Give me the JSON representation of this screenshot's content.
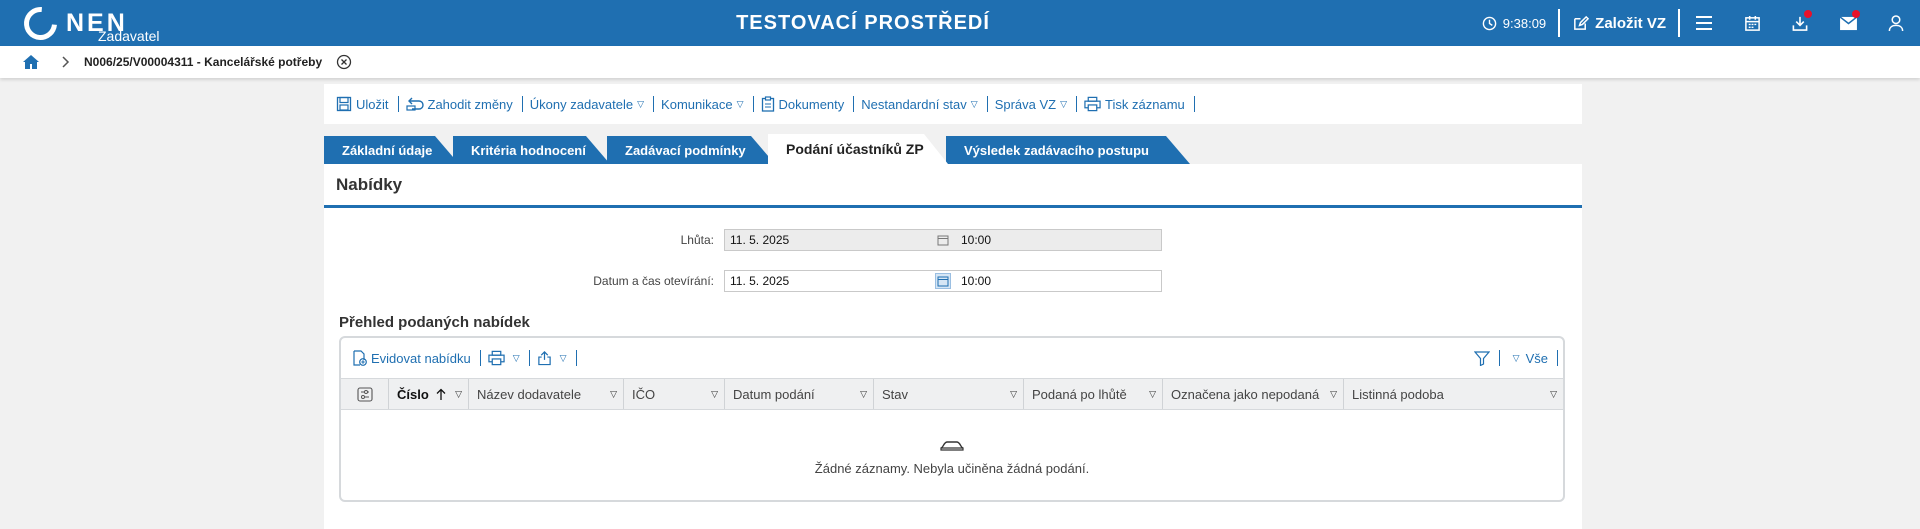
{
  "header": {
    "logo_text": "NEN",
    "logo_sub": "Zadavatel",
    "environment_title": "TESTOVACÍ PROSTŘEDÍ",
    "clock": "9:38:09",
    "create_label": "Založit VZ",
    "icons": [
      "clock-icon",
      "edit-icon",
      "menu-icon",
      "calendar-icon",
      "download-icon",
      "mail-icon",
      "user-icon"
    ]
  },
  "breadcrumb": {
    "label": "N006/25/V00004311 - Kancelářské potřeby"
  },
  "toolbar": {
    "save": "Uložit",
    "discard": "Zahodit změny",
    "actions": "Úkony zadavatele",
    "communication": "Komunikace",
    "documents": "Dokumenty",
    "nonstandard": "Nestandardní stav",
    "management": "Správa VZ",
    "print": "Tisk záznamu"
  },
  "tabs": [
    {
      "label": "Základní údaje"
    },
    {
      "label": "Kritéria hodnocení"
    },
    {
      "label": "Zadávací podmínky"
    },
    {
      "label": "Podání účastníků ZP",
      "active": true
    },
    {
      "label": "Výsledek zadávacího postupu"
    }
  ],
  "section": {
    "title": "Nabídky",
    "deadline": {
      "label": "Lhůta:",
      "date": "11. 5. 2025",
      "time": "10:00"
    },
    "opening": {
      "label": "Datum a čas otevírání:",
      "date": "11. 5. 2025",
      "time": "10:00"
    },
    "overview_title": "Přehled podaných nabídek"
  },
  "grid": {
    "add_offer": "Evidovat nabídku",
    "filter_all": "Vše",
    "columns": [
      "Číslo",
      "Název dodavatele",
      "IČO",
      "Datum podání",
      "Stav",
      "Podaná po lhůtě",
      "Označena jako nepodaná",
      "Listinná podoba"
    ],
    "empty_text": "Žádné záznamy. Nebyla učiněna žádná podání."
  },
  "colors": {
    "primary": "#1f6fb1",
    "notification": "#e8102a"
  }
}
